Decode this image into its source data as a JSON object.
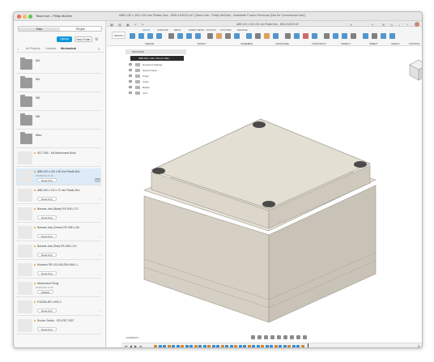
{
  "window": {
    "title": "ABB 100 x 100 x 50 mm Plastic Box - BS# 4X4915 v6* (Team hub - Philip McGee) - Autodesk Fusion Personal (Not for Commercial Use)",
    "hub_name": "Team hub - Philip McGee",
    "doc_tab": "ABB 100 x 100 x 50 mm Plastic Box - BS# 4X4915 v6*"
  },
  "left_panel": {
    "segment_data": "Data",
    "segment_people": "People",
    "upload_label": "Upload",
    "new_folder_label": "New Folder",
    "breadcrumb_all": "All Projects",
    "breadcrumb_mid": "Libraries",
    "breadcrumb_current": "Mechanical",
    "folders": [
      {
        "name": "M3"
      },
      {
        "name": "M4"
      },
      {
        "name": "M5"
      },
      {
        "name": "M6"
      },
      {
        "name": "Misc"
      }
    ],
    "files": [
      {
        "name": "ISO 7380 - M4 Buttonhead Bolts",
        "date": "",
        "status": "",
        "version": "",
        "selected": false
      },
      {
        "name": "ABB 100 x 100 x 50 mm Plastic Box",
        "date": "10/05/2024 11:45",
        "status": "Read-Only",
        "version": "V6",
        "selected": true
      },
      {
        "name": "ABB 150 x 110 x 70 mm Plastic Box",
        "date": "",
        "status": "Read-Only",
        "version": "",
        "selected": false
      },
      {
        "name": "Banana Jack (Black) RS 4081-174",
        "date": "",
        "status": "Read-Only",
        "version": "",
        "selected": false
      },
      {
        "name": "Banana Jack (Green) RS 4081-146",
        "date": "",
        "status": "Read-Only",
        "version": "",
        "selected": false
      },
      {
        "name": "Banana Jack (Red) RS 4081-174",
        "date": "",
        "status": "Read-Only",
        "version": "",
        "selected": false
      },
      {
        "name": "Mounted PB 100-X5A RS# 6941-1",
        "date": "",
        "status": "Read-Only",
        "version": "",
        "selected": false
      },
      {
        "name": "Mechanical Fixing",
        "date": "10/05/2024 11:35",
        "status": "Editable",
        "version": "",
        "selected": false
      },
      {
        "name": "P1003A-BF1-HSS-2",
        "date": "",
        "status": "Read-Only",
        "version": "",
        "selected": false
      },
      {
        "name": "Rocker Switch - RS 6787-7807",
        "date": "",
        "status": "Read-Only",
        "version": "",
        "selected": false
      }
    ]
  },
  "ribbon": {
    "design_menu": "DESIGN",
    "tabs": [
      "SOLID",
      "SURFACE",
      "MESH",
      "SHEET METAL",
      "PLASTIC",
      "UTILITIES",
      "MANAGE"
    ],
    "groups": [
      "CREATE",
      "MODIFY",
      "ASSEMBLE",
      "CONFIGURE",
      "CONSTRUCT",
      "INSPECT",
      "INSERT",
      "SELECT",
      "POSITION"
    ]
  },
  "browser": {
    "header": "BROWSER",
    "root": "ABB 100 x 100 x 50 mm Plas...",
    "items": [
      "Document Settings",
      "Named Views",
      "Origin",
      "Joints",
      "Bodies",
      "Lid:1"
    ]
  },
  "comments_label": "COMMENTS",
  "colors": {
    "accent": "#0696d7",
    "selected_row": "#dcebf7",
    "box_body": "#e3ddd1",
    "box_shadow": "#cfc9bc",
    "corner": "#4a4a4a"
  }
}
